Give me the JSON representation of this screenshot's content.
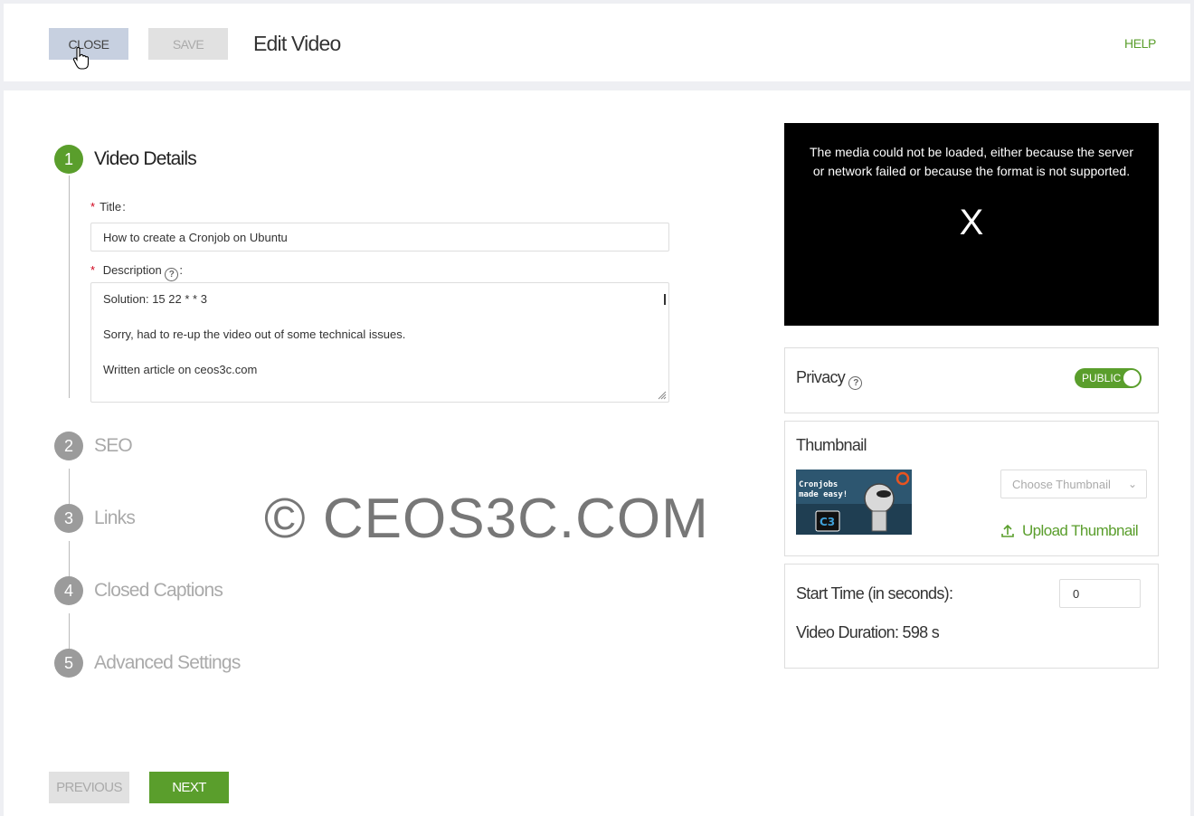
{
  "header": {
    "close_label": "CLOSE",
    "save_label": "SAVE",
    "title": "Edit Video",
    "help_label": "HELP"
  },
  "steps": [
    {
      "num": "1",
      "label": "Video Details"
    },
    {
      "num": "2",
      "label": "SEO"
    },
    {
      "num": "3",
      "label": "Links"
    },
    {
      "num": "4",
      "label": "Closed Captions"
    },
    {
      "num": "5",
      "label": "Advanced Settings"
    }
  ],
  "form": {
    "title_label": "Title",
    "title_value": "How to create a Cronjob on Ubuntu",
    "description_label": "Description",
    "description_lines": [
      "Solution: 15 22 * * 3",
      "Sorry, had to re-up the video out of some technical issues.",
      "Written article on ceos3c.com"
    ]
  },
  "watermark": "© CEOS3C.COM",
  "video": {
    "error_line1": "The media could not be loaded, either because the server",
    "error_line2": "or network failed or because the format is not supported.",
    "x_glyph": "X"
  },
  "privacy": {
    "label": "Privacy",
    "toggle_label": "PUBLIC"
  },
  "thumbnail": {
    "label": "Thumbnail",
    "choose_placeholder": "Choose Thumbnail",
    "upload_label": "Upload Thumbnail",
    "image_text_1": "Cronjobs",
    "image_text_2": "made easy!"
  },
  "timing": {
    "start_label": "Start Time (in seconds):",
    "start_value": "0",
    "duration_label": "Video Duration: 598 s"
  },
  "footer": {
    "previous_label": "PREVIOUS",
    "next_label": "NEXT"
  },
  "colors": {
    "accent_green": "#5a9e2c",
    "close_button_bg": "#c7d0e0",
    "disabled_bg": "#e1e1e1"
  }
}
